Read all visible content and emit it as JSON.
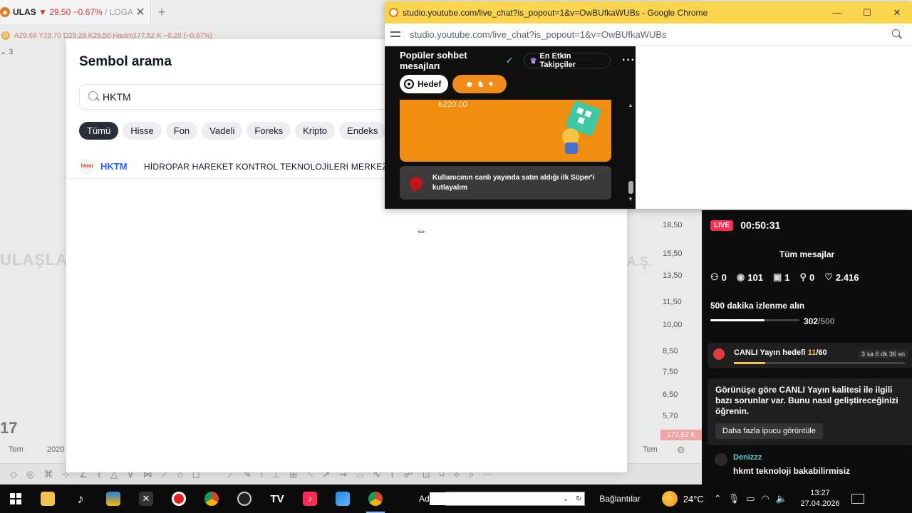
{
  "tv": {
    "tab_symbol": "ULAS",
    "tab_change": "▼ 29,50 −0.67%",
    "tab_suffix": "/ LOGA",
    "new_tab": "+",
    "info_line": "A29,68 Y29,70 D29,28 K29,50 Hacim177,52 K −0,20 (−0,67%)",
    "info_letter": "D",
    "left_count": "3",
    "watermark": "ULAŞLAR",
    "watermark_right": "A.Ş.",
    "prices": [
      "18,50",
      "15,50",
      "13,50",
      "11,50",
      "10,00",
      "8,50",
      "7,50",
      "6,50",
      "5,70"
    ],
    "volume_label": "177,52 K",
    "date_left": "Tem",
    "date_2020": "2020",
    "date_right": "Tem",
    "logo_text": "17"
  },
  "dialog": {
    "title": "Sembol arama",
    "search_value": "HKTM",
    "filters": [
      "Tümü",
      "Hisse",
      "Fon",
      "Vadeli",
      "Foreks",
      "Kripto",
      "Endeks"
    ],
    "active_filter": "Tümü",
    "result": {
      "logo_text": "hktm",
      "symbol": "HKTM",
      "description": "HİDROPAR HAREKET KONTROL TEKNOLOJİLERİ MERKEZİ SA"
    }
  },
  "chrome": {
    "title": "studio.youtube.com/live_chat?is_popout=1&v=OwBUfkaWUBs - Google Chrome",
    "url": "studio.youtube.com/live_chat?is_popout=1&v=OwBUfkaWUBs",
    "min": "—",
    "max": "☐",
    "close": "✕"
  },
  "chat": {
    "title": "Popüler sohbet mesajları",
    "supporters_label": "En Etkin Takipçiler",
    "goal_chip": "Hedef",
    "superchat_amount": "₺220,00",
    "super_text_line1": "Kullanıcının canlı yayında satın aldığı ilk Süper'i",
    "super_text_line2": "kutlayalım"
  },
  "stream": {
    "live_badge": "LIVE",
    "timer": "00:50:31",
    "all_messages": "Tüm mesajlar",
    "stats": {
      "users": "0",
      "viewers": "101",
      "gifts": "1",
      "shares": "0",
      "likes": "2.416"
    },
    "watch_title": "500 dakika izlenme alın",
    "watch_current": "302",
    "watch_total": "/500",
    "watch_progress": 0.604,
    "goal_prefix": "CANLI Yayın hedefi ",
    "goal_current": "11",
    "goal_total": "/60",
    "goal_progress": 0.183,
    "goal_time": "3 sa 6 dk 36 sn",
    "tip_text": "Görünüşe göre CANLI Yayın kalitesi ile ilgili bazı sorunlar var. Bunu nasıl geliştireceğinizi öğrenin.",
    "tip_button": "Daha fazla ipucu görüntüle",
    "comment_user": "Denizzz",
    "comment_text": "hkmt teknoloji bakabilirmisiz"
  },
  "taskbar": {
    "address_label": "Adres",
    "links_label": "Bağlantılar",
    "temperature": "24°C",
    "time": "13:27",
    "date": "27.04.2026"
  },
  "colors": {
    "chrome_title_bg": "#fcd54f",
    "superchat": "#f08c10",
    "live": "#fe2c55",
    "link_blue": "#2962ff"
  }
}
